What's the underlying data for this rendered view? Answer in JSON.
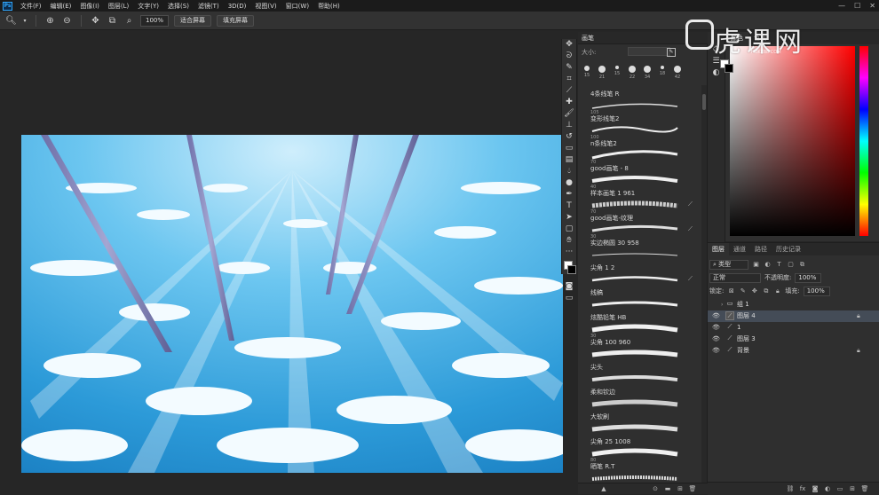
{
  "menubar": {
    "items": [
      "文件(F)",
      "编辑(E)",
      "图像(I)",
      "图层(L)",
      "文字(Y)",
      "选择(S)",
      "滤镜(T)",
      "3D(D)",
      "视图(V)",
      "窗口(W)",
      "帮助(H)"
    ]
  },
  "optionsbar": {
    "zoom_value": "100%",
    "fit_screen": "适合屏幕",
    "fill_screen": "填充屏幕"
  },
  "brush_panel": {
    "title": "画笔",
    "size_label": "大小:",
    "recent_brushes": [
      "15",
      "21",
      "15",
      "22",
      "34",
      "18",
      "42"
    ],
    "brushes": [
      {
        "size": "",
        "name": "4条线笔 R"
      },
      {
        "size": "105",
        "name": "变形线笔2"
      },
      {
        "size": "100",
        "name": "n条线笔2"
      },
      {
        "size": "70",
        "name": "good画笔 - 8"
      },
      {
        "size": "40",
        "name": "样本画笔 1 961"
      },
      {
        "size": "70",
        "name": "good画笔-纹理"
      },
      {
        "size": "30",
        "name": "实边椭圆 30 958"
      },
      {
        "size": "",
        "name": "尖角 1 2"
      },
      {
        "size": "",
        "name": "线稿"
      },
      {
        "size": "",
        "name": "炫酷铅笔 HB"
      },
      {
        "size": "30",
        "name": "尖角 100 960"
      },
      {
        "size": "",
        "name": "尖头"
      },
      {
        "size": "",
        "name": "柔和钦边"
      },
      {
        "size": "",
        "name": "大软刷"
      },
      {
        "size": "",
        "name": "尖角 25 1008"
      },
      {
        "size": "80",
        "name": "晒笔 R.T"
      }
    ]
  },
  "color_panel": {
    "tabs": [
      "颜色",
      "色板"
    ],
    "fg_color": "#ffffff",
    "bg_color": "#000000"
  },
  "layers_panel": {
    "tabs": [
      "图层",
      "通道",
      "路径",
      "历史记录"
    ],
    "filter_kind": "类型",
    "blend_mode": "正常",
    "opacity_label": "不透明度:",
    "opacity_value": "100%",
    "lock_label": "锁定:",
    "fill_label": "填充:",
    "fill_value": "100%",
    "layers": [
      {
        "name": "组 1",
        "type": "group",
        "selected": false,
        "locked": false,
        "visible": false
      },
      {
        "name": "图层 4",
        "type": "layer",
        "selected": true,
        "locked": true,
        "visible": true
      },
      {
        "name": "1",
        "type": "layer",
        "selected": false,
        "locked": false,
        "visible": true
      },
      {
        "name": "图层 3",
        "type": "layer",
        "selected": false,
        "locked": false,
        "visible": true
      },
      {
        "name": "背景",
        "type": "layer",
        "selected": false,
        "locked": true,
        "visible": true
      }
    ]
  },
  "watermark": {
    "text": "虎课网",
    "sub": "HUKE88.COM"
  },
  "accent_color": "#31a8ff",
  "panel_bg": "#2f2f2f"
}
